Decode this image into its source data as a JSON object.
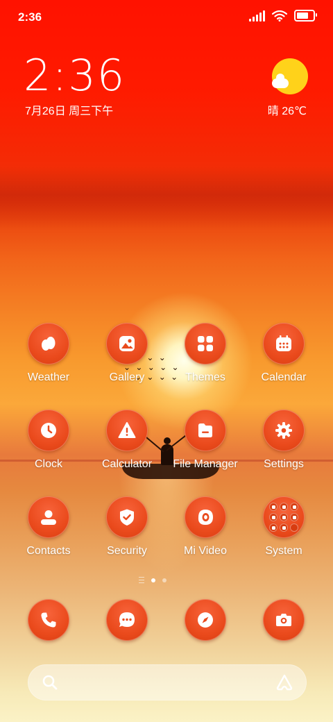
{
  "status_bar": {
    "time": "2:36",
    "battery_level": 0.9
  },
  "clock_widget": {
    "time": "2:36",
    "date": "7月26日 周三下午"
  },
  "weather_widget": {
    "icon": "sun-cloud-icon",
    "text": "晴 26℃"
  },
  "apps": [
    {
      "label": "Weather",
      "icon": "weather-icon"
    },
    {
      "label": "Gallery",
      "icon": "gallery-icon"
    },
    {
      "label": "Themes",
      "icon": "themes-icon"
    },
    {
      "label": "Calendar",
      "icon": "calendar-icon"
    },
    {
      "label": "Clock",
      "icon": "clock-icon"
    },
    {
      "label": "Calculator",
      "icon": "calculator-icon"
    },
    {
      "label": "File Manager",
      "icon": "file-manager-icon"
    },
    {
      "label": "Settings",
      "icon": "settings-icon"
    },
    {
      "label": "Contacts",
      "icon": "contacts-icon"
    },
    {
      "label": "Security",
      "icon": "security-icon"
    },
    {
      "label": "Mi Video",
      "icon": "mi-video-icon"
    },
    {
      "label": "System",
      "icon": "system-folder-icon"
    }
  ],
  "page_indicator": {
    "current_page": 1,
    "total_pages": 2
  },
  "dock": [
    {
      "icon": "phone-icon"
    },
    {
      "icon": "messages-icon"
    },
    {
      "icon": "browser-icon"
    },
    {
      "icon": "camera-icon"
    }
  ],
  "search_bar": {
    "search_icon": "search-icon",
    "assistant_icon": "assistant-icon"
  },
  "colors": {
    "icon_bg": "#ea4a1c",
    "sky_top": "#ff1200",
    "sun": "#ffd21a"
  }
}
